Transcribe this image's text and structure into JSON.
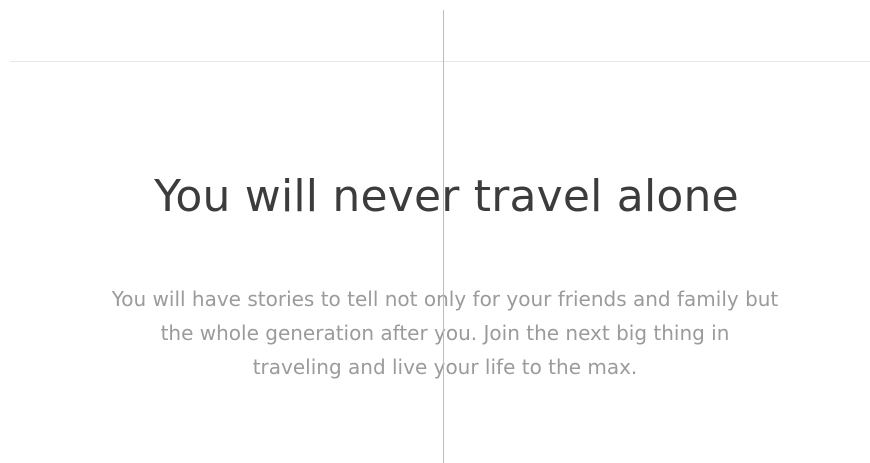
{
  "hero": {
    "title": "You will never travel alone",
    "paragraph_lines": [
      "You will have stories to tell not only for your friends and family but",
      "the whole generation after you. Join the next big thing in",
      "traveling and live your life to the max."
    ]
  },
  "colors": {
    "background": "#ffffff",
    "title": "#3c3c3c",
    "body_text": "#9b9b9b",
    "divider": "#e6e6e6",
    "guide_line": "#5fe3e6"
  }
}
